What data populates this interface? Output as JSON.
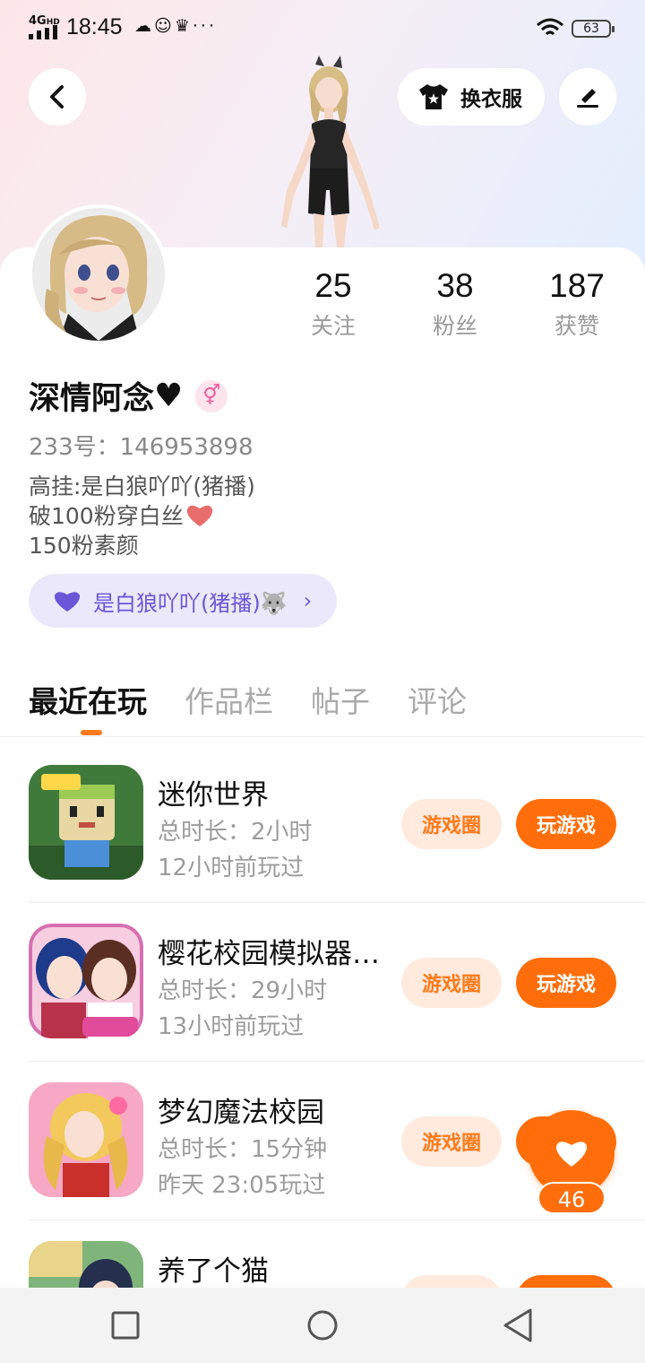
{
  "status_bar": {
    "network": "4G",
    "network_sub": "HD",
    "time": "18:45",
    "notif_icons": [
      "cloud-icon",
      "wechat-icon",
      "crown-icon",
      "more-icon"
    ],
    "battery": "63"
  },
  "header": {
    "outfit_label": "换衣服"
  },
  "profile": {
    "stats": [
      {
        "value": "25",
        "label": "关注"
      },
      {
        "value": "38",
        "label": "粉丝"
      },
      {
        "value": "187",
        "label": "获赞"
      }
    ],
    "name": "深情阿念",
    "name_suffix": "♥",
    "gender_symbol": "⚥",
    "uid": "233号：146953898",
    "bio_lines": [
      "高挂:是白狼吖吖(猪播)",
      "破100粉穿白丝",
      "150粉素颜"
    ],
    "fan_tag": "是白狼吖吖(猪播)🐺"
  },
  "tabs": [
    "最近在玩",
    "作品栏",
    "帖子",
    "评论"
  ],
  "games": [
    {
      "title": "迷你世界",
      "duration": "总时长：2小时",
      "last_played": "12小时前玩过",
      "circle_label": "游戏圈",
      "play_label": "玩游戏"
    },
    {
      "title": "樱花校园模拟器…",
      "duration": "总时长：29小时",
      "last_played": "13小时前玩过",
      "circle_label": "游戏圈",
      "play_label": "玩游戏"
    },
    {
      "title": "梦幻魔法校园",
      "duration": "总时长：15分钟",
      "last_played": "昨天 23:05玩过",
      "circle_label": "游戏圈",
      "play_label": "玩游戏"
    },
    {
      "title": "养了个猫",
      "duration": "",
      "last_played": "",
      "circle_label": "",
      "play_label": ""
    }
  ],
  "fab": {
    "count": "46"
  },
  "colors": {
    "accent": "#ff6e0a",
    "accent_light": "#ffeadd",
    "tag_bg": "#ebe8fb",
    "tag_text": "#6b56d8"
  }
}
